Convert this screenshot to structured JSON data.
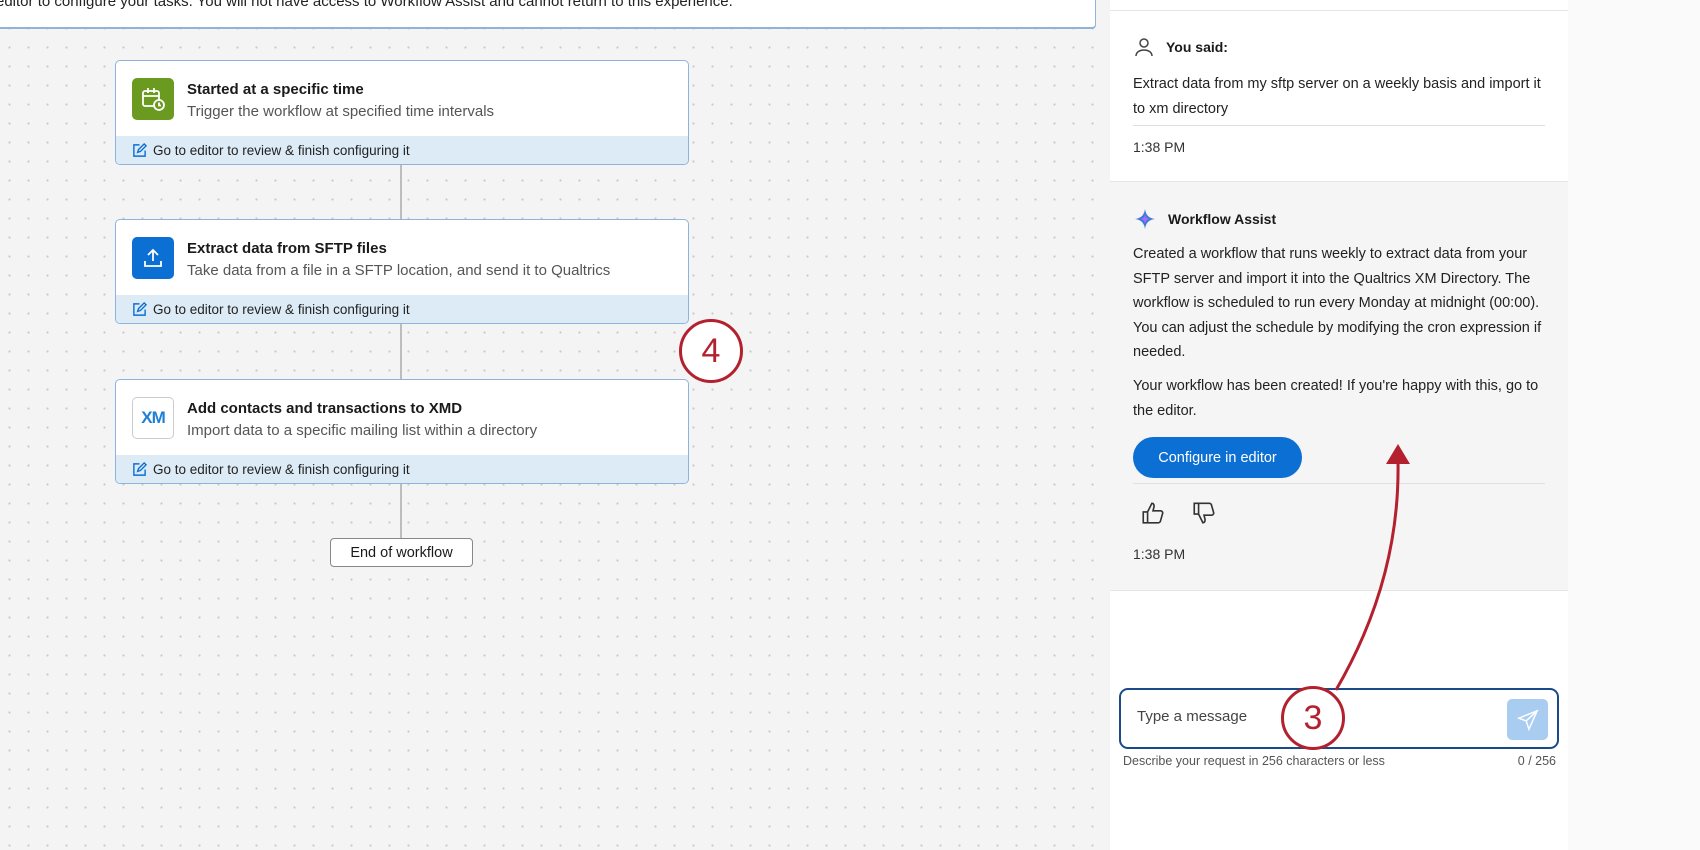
{
  "banner": {
    "text": "editor to configure your tasks. You will not have access to Workflow Assist and cannot return to this experience."
  },
  "workflow": {
    "steps": [
      {
        "title": "Started at a specific time",
        "description": "Trigger the workflow at specified time intervals",
        "footer": "Go to editor to review & finish configuring it",
        "icon": "calendar-clock-icon",
        "color": "#6a9a1f"
      },
      {
        "title": "Extract data from SFTP files",
        "description": "Take data from a file in a SFTP location, and send it to Qualtrics",
        "footer": "Go to editor to review & finish configuring it",
        "icon": "upload-icon",
        "color": "#0b6fd3"
      },
      {
        "title": "Add contacts and transactions to XMD",
        "description": "Import data to a specific mailing list within a directory",
        "footer": "Go to editor to review & finish configuring it",
        "icon": "xm-logo-icon",
        "logo_text": "XM"
      }
    ],
    "end_label": "End of workflow"
  },
  "chat": {
    "user": {
      "label": "You said:",
      "message": "Extract data from my sftp server on a weekly basis and import it to xm directory",
      "time": "1:38 PM"
    },
    "assistant": {
      "label": "Workflow Assist",
      "message1": "Created a workflow that runs weekly to extract data from your SFTP server and import it into the Qualtrics XM Directory. The workflow is scheduled to run every Monday at midnight (00:00). You can adjust the schedule by modifying the cron expression if needed.",
      "message2": "Your workflow has been created! If you're happy with this, go to the editor.",
      "button": "Configure in editor",
      "time": "1:38 PM"
    },
    "input": {
      "placeholder": "Type a message",
      "hint": "Describe your request in 256 characters or less",
      "counter": "0 / 256"
    }
  },
  "annotations": {
    "step3": "3",
    "step4": "4"
  }
}
